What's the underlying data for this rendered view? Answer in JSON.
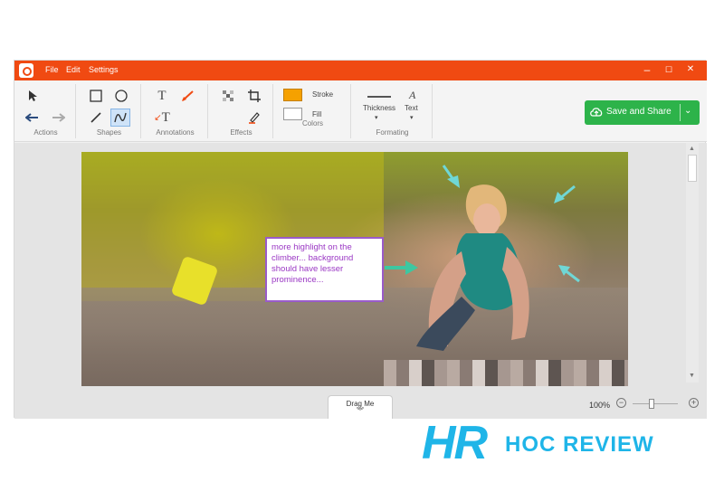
{
  "menu": {
    "file": "File",
    "edit": "Edit",
    "settings": "Settings"
  },
  "window": {
    "minimize": "–",
    "maximize": "☐",
    "close": "✕"
  },
  "groups": {
    "actions": "Actions",
    "shapes": "Shapes",
    "annotations": "Annotations",
    "effects": "Effects",
    "colors": "Colors",
    "formating": "Formating"
  },
  "colors": {
    "stroke_label": "Stroke",
    "fill_label": "Fill",
    "stroke_color": "#f5a100",
    "fill_color": "#ffffff",
    "accent": "#f04a12",
    "save_color": "#2db34a",
    "note_border": "#9a5bc9"
  },
  "formatting": {
    "thickness_label": "Thickness",
    "text_label": "Text"
  },
  "save": {
    "label": "Save and Share"
  },
  "note": {
    "text": "more highlight on the climber... background should have lesser prominence..."
  },
  "drag": {
    "label": "Drag Me"
  },
  "zoom": {
    "level": "100%"
  },
  "brand": {
    "text": "HOC REVIEW",
    "logo": "HR"
  }
}
